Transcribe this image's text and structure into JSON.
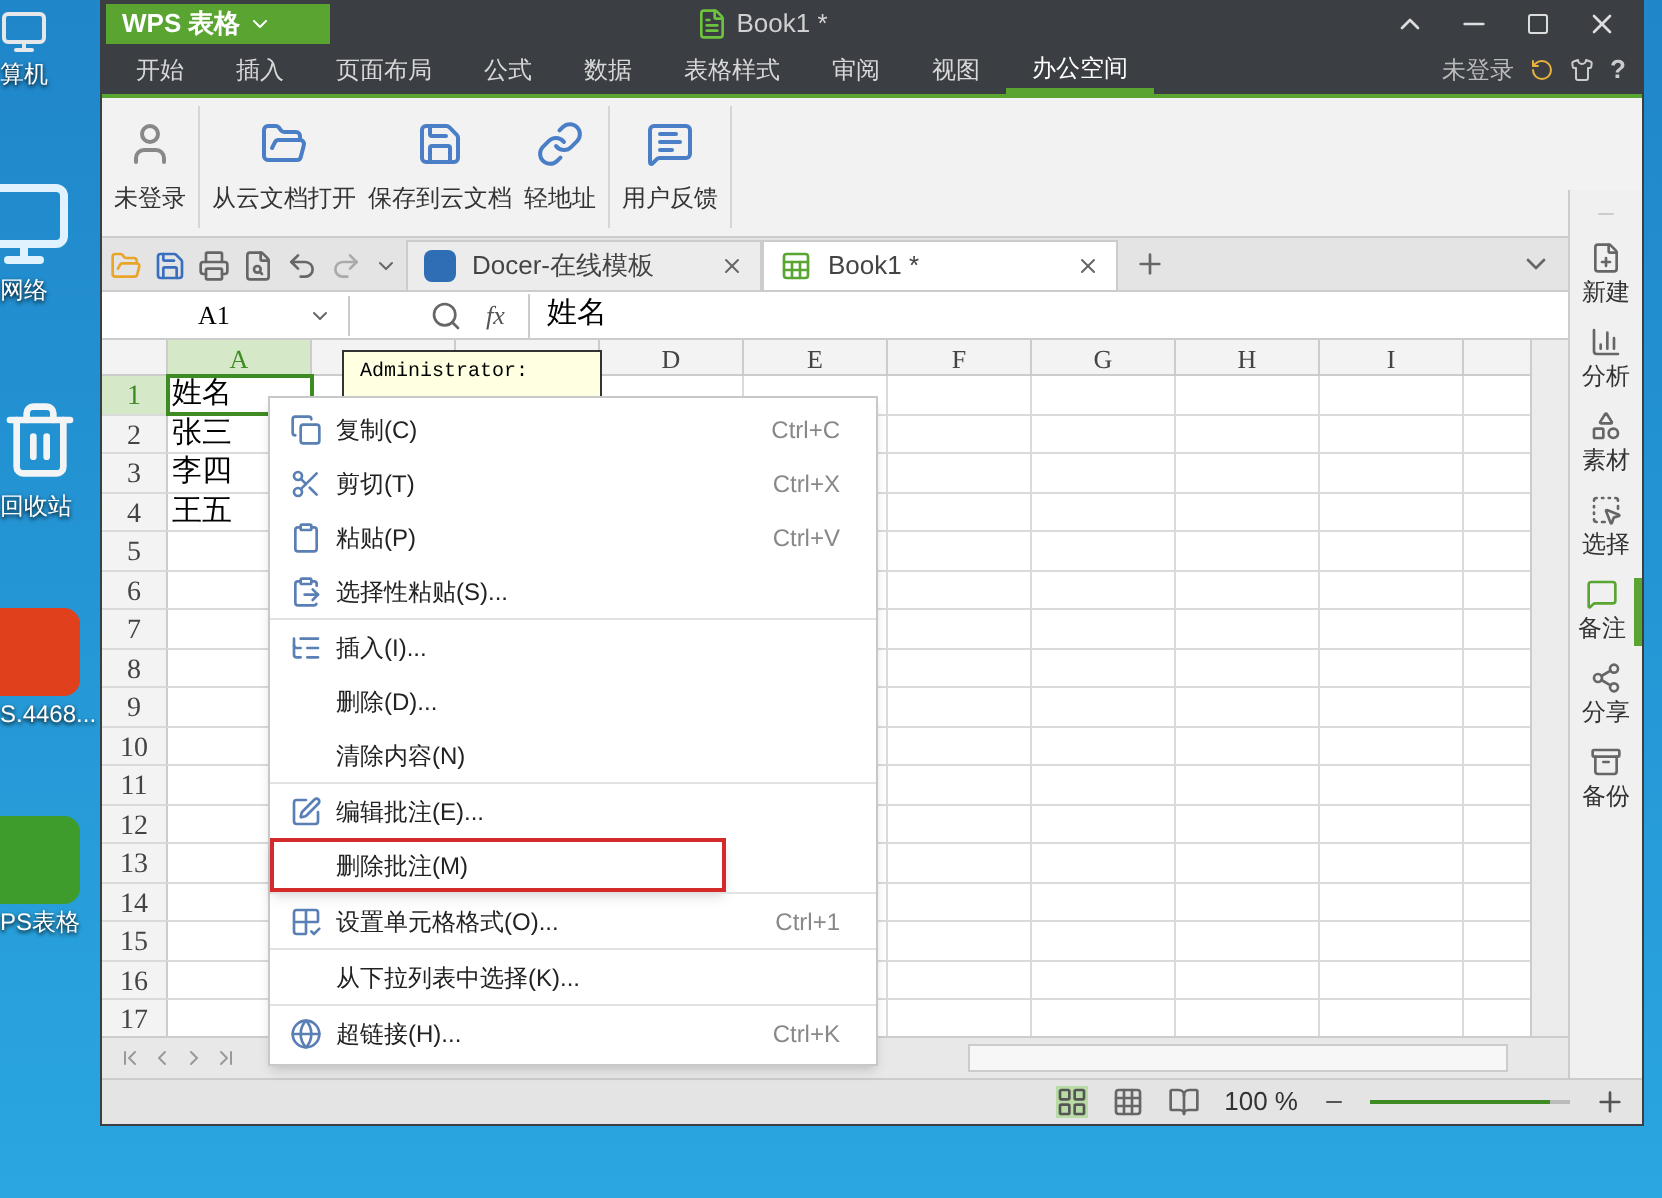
{
  "desktop_icons": [
    {
      "kind": "computer",
      "label": "算机"
    },
    {
      "kind": "network",
      "label": "网络"
    },
    {
      "kind": "recycle",
      "label": "回收站"
    },
    {
      "kind": "wps-orange",
      "label": "S.4468..."
    },
    {
      "kind": "wps-green",
      "label": "PS表格"
    }
  ],
  "window": {
    "app_button": "WPS 表格",
    "title": "Book1 *"
  },
  "menu_tabs": [
    {
      "label": "开始",
      "selected": false
    },
    {
      "label": "插入",
      "selected": false
    },
    {
      "label": "页面布局",
      "selected": false
    },
    {
      "label": "公式",
      "selected": false
    },
    {
      "label": "数据",
      "selected": false
    },
    {
      "label": "表格样式",
      "selected": false
    },
    {
      "label": "审阅",
      "selected": false
    },
    {
      "label": "视图",
      "selected": false
    },
    {
      "label": "办公空间",
      "selected": true
    }
  ],
  "account": {
    "label": "未登录",
    "help": "?"
  },
  "ribbon_groups": [
    [
      {
        "kind": "user",
        "label": "未登录"
      }
    ],
    [
      {
        "kind": "open",
        "label": "从云文档打开"
      },
      {
        "kind": "save",
        "label": "保存到云文档"
      },
      {
        "kind": "link",
        "label": "轻地址"
      }
    ],
    [
      {
        "kind": "feedback",
        "label": "用户反馈"
      }
    ]
  ],
  "doc_tabs": [
    {
      "kind": "docer",
      "label": "Docer-在线模板",
      "selected": false
    },
    {
      "kind": "book",
      "label": "Book1 *",
      "selected": true
    }
  ],
  "formula_bar": {
    "name_box": "A1",
    "fx": "fx",
    "value": "姓名"
  },
  "sheet": {
    "columns": [
      {
        "label": "A",
        "selected": true
      },
      {
        "selected": false
      },
      {
        "selected": false
      },
      {
        "label": "D",
        "selected": false
      },
      {
        "label": "E",
        "selected": false
      },
      {
        "label": "F",
        "selected": false
      },
      {
        "label": "G",
        "selected": false
      },
      {
        "label": "H",
        "selected": false
      },
      {
        "label": "I",
        "selected": false
      }
    ],
    "rows": [
      {
        "label": "1",
        "selected": true,
        "cells": [
          "姓名"
        ]
      },
      {
        "label": "2",
        "selected": false,
        "cells": [
          "张三"
        ]
      },
      {
        "label": "3",
        "selected": false,
        "cells": [
          "李四"
        ]
      },
      {
        "label": "4",
        "selected": false,
        "cells": [
          "王五"
        ]
      },
      {
        "label": "5",
        "selected": false,
        "cells": []
      },
      {
        "label": "6",
        "selected": false,
        "cells": []
      },
      {
        "label": "7",
        "selected": false,
        "cells": []
      },
      {
        "label": "8",
        "selected": false,
        "cells": []
      },
      {
        "label": "9",
        "selected": false,
        "cells": []
      },
      {
        "label": "10",
        "selected": false,
        "cells": []
      },
      {
        "label": "11",
        "selected": false,
        "cells": []
      },
      {
        "label": "12",
        "selected": false,
        "cells": []
      },
      {
        "label": "13",
        "selected": false,
        "cells": []
      },
      {
        "label": "14",
        "selected": false,
        "cells": []
      },
      {
        "label": "15",
        "selected": false,
        "cells": []
      },
      {
        "label": "16",
        "selected": false,
        "cells": []
      },
      {
        "label": "17",
        "selected": false,
        "cells": []
      }
    ],
    "comment": {
      "author": "Administrator:"
    }
  },
  "context_menu": [
    [
      {
        "kind": "copy",
        "label": "复制(C)",
        "shortcut": "Ctrl+C",
        "highlighted": false
      },
      {
        "kind": "cut",
        "label": "剪切(T)",
        "shortcut": "Ctrl+X",
        "highlighted": false
      },
      {
        "kind": "paste",
        "label": "粘贴(P)",
        "shortcut": "Ctrl+V",
        "highlighted": false
      },
      {
        "kind": "paste-special",
        "label": "选择性粘贴(S)...",
        "highlighted": false
      }
    ],
    [
      {
        "kind": "insert",
        "label": "插入(I)...",
        "highlighted": false
      },
      {
        "kind": "plain",
        "label": "删除(D)...",
        "highlighted": false
      },
      {
        "kind": "plain",
        "label": "清除内容(N)",
        "highlighted": false
      }
    ],
    [
      {
        "kind": "edit-note",
        "label": "编辑批注(E)...",
        "highlighted": false
      },
      {
        "kind": "plain",
        "label": "删除批注(M)",
        "highlighted": true
      }
    ],
    [
      {
        "kind": "format",
        "label": "设置单元格格式(O)...",
        "shortcut": "Ctrl+1",
        "highlighted": false
      }
    ],
    [
      {
        "kind": "plain",
        "label": "从下拉列表中选择(K)...",
        "highlighted": false
      }
    ],
    [
      {
        "kind": "hyperlink",
        "label": "超链接(H)...",
        "shortcut": "Ctrl+K",
        "highlighted": false
      }
    ]
  ],
  "side_panel": [
    {
      "kind": "new",
      "label": "新建",
      "selected": false
    },
    {
      "kind": "analyze",
      "label": "分析",
      "selected": false
    },
    {
      "kind": "material",
      "label": "素材",
      "selected": false
    },
    {
      "kind": "select",
      "label": "选择",
      "selected": false
    },
    {
      "kind": "note",
      "label": "备注",
      "selected": true
    },
    {
      "kind": "share",
      "label": "分享",
      "selected": false
    },
    {
      "kind": "backup",
      "label": "备份",
      "selected": false
    }
  ],
  "status_bar": {
    "views": [
      {
        "kind": "normal",
        "selected": true
      },
      {
        "kind": "page-break",
        "selected": false
      },
      {
        "kind": "reading",
        "selected": false
      }
    ],
    "zoom": "100 %",
    "zoom_slider": {
      "level": 0.9
    }
  }
}
